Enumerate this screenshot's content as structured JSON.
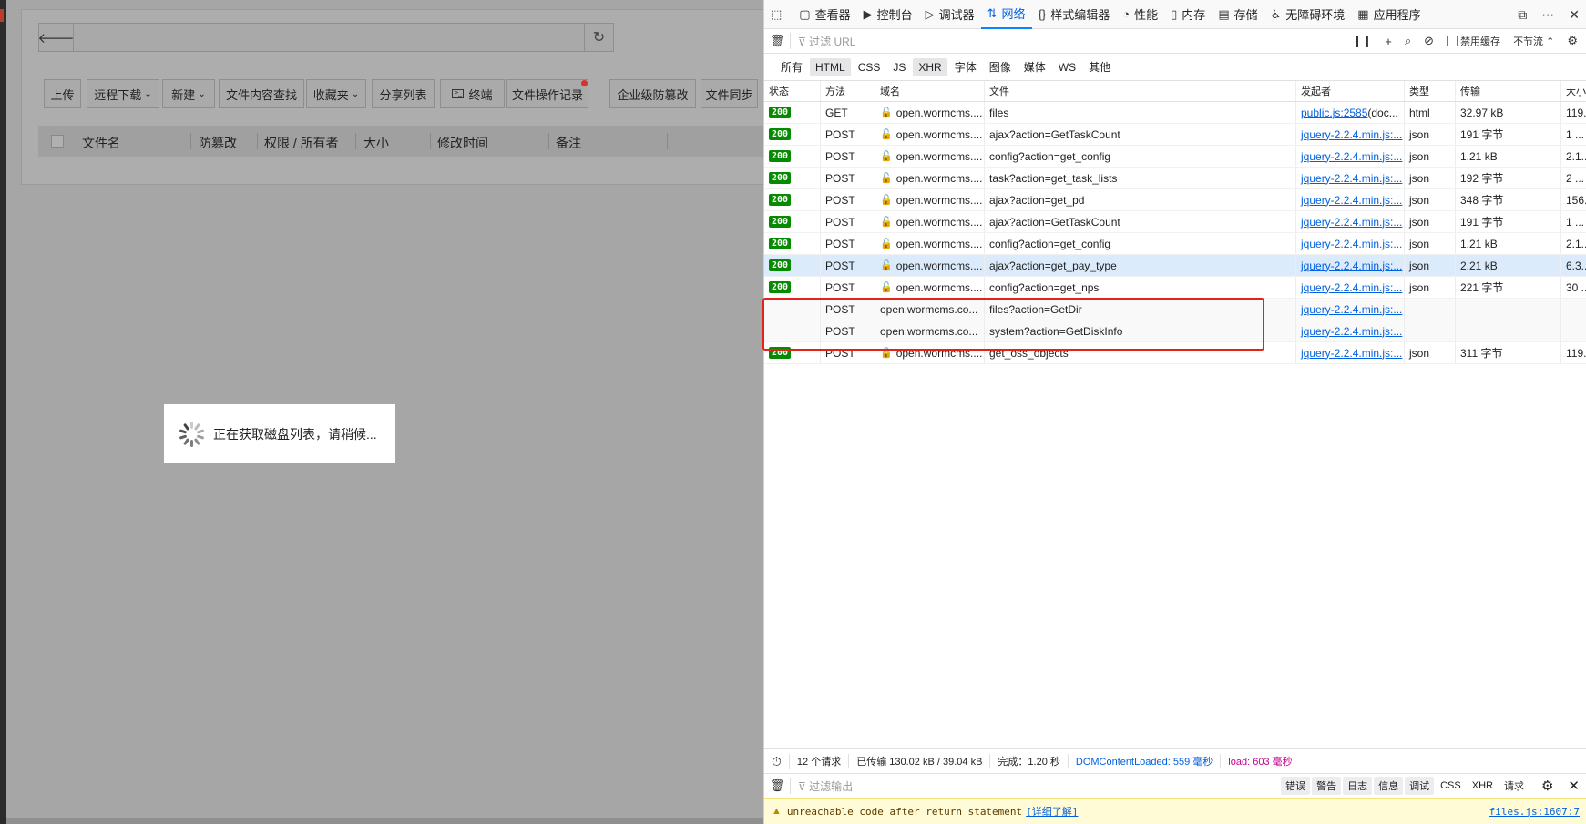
{
  "app": {
    "toolbar": [
      {
        "label": "上传"
      },
      {
        "label": "远程下载",
        "caret": true
      },
      {
        "label": "新建",
        "caret": true
      },
      {
        "label": "文件内容查找"
      },
      {
        "label": "收藏夹",
        "caret": true
      },
      {
        "label": "分享列表"
      },
      {
        "label": "终端",
        "icon": "terminal-icon"
      },
      {
        "label": "文件操作记录",
        "dot": true
      },
      {
        "label": "企业级防篡改"
      },
      {
        "label": "文件同步"
      }
    ],
    "columns": {
      "name": "文件名",
      "tamper": "防篡改",
      "perm": "权限 / 所有者",
      "size": "大小",
      "mtime": "修改时间",
      "note": "备注"
    },
    "loading_text": "正在获取磁盘列表，请稍候..."
  },
  "devtools": {
    "tabs": [
      {
        "icon": "▢",
        "label": "查看器"
      },
      {
        "icon": "▶",
        "label": "控制台"
      },
      {
        "icon": "▷",
        "label": "调试器"
      },
      {
        "icon": "⇅",
        "label": "网络",
        "active": true
      },
      {
        "icon": "{}",
        "label": "样式编辑器"
      },
      {
        "icon": "◔",
        "label": "性能"
      },
      {
        "icon": "▯",
        "label": "内存"
      },
      {
        "icon": "▤",
        "label": "存储"
      },
      {
        "icon": "♿",
        "label": "无障碍环境"
      },
      {
        "icon": "▦",
        "label": "应用程序"
      }
    ],
    "filter_placeholder": "过滤 URL",
    "disable_cache": "禁用缓存",
    "throttle": "不节流 ⌃",
    "types": [
      {
        "label": "所有"
      },
      {
        "label": "HTML",
        "on": true
      },
      {
        "label": "CSS"
      },
      {
        "label": "JS"
      },
      {
        "label": "XHR",
        "on": true
      },
      {
        "label": "字体"
      },
      {
        "label": "图像"
      },
      {
        "label": "媒体"
      },
      {
        "label": "WS"
      },
      {
        "label": "其他"
      }
    ],
    "headers": {
      "status": "状态",
      "method": "方法",
      "domain": "域名",
      "file": "文件",
      "initiator": "发起者",
      "type": "类型",
      "transferred": "传输",
      "size": "大小"
    },
    "requests": [
      {
        "status": "200",
        "method": "GET",
        "domain": "open.wormcms....",
        "insecure": true,
        "file": "files",
        "initiator": "public.js:2585",
        "initiator_extra": " (doc...",
        "type": "html",
        "transferred": "32.97 kB",
        "size": "119..."
      },
      {
        "status": "200",
        "method": "POST",
        "domain": "open.wormcms....",
        "insecure": true,
        "file": "ajax?action=GetTaskCount",
        "initiator": "jquery-2.2.4.min.js:...",
        "type": "json",
        "transferred": "191 字节",
        "size": "1 ..."
      },
      {
        "status": "200",
        "method": "POST",
        "domain": "open.wormcms....",
        "insecure": true,
        "file": "config?action=get_config",
        "initiator": "jquery-2.2.4.min.js:...",
        "type": "json",
        "transferred": "1.21 kB",
        "size": "2.1..."
      },
      {
        "status": "200",
        "method": "POST",
        "domain": "open.wormcms....",
        "insecure": true,
        "file": "task?action=get_task_lists",
        "initiator": "jquery-2.2.4.min.js:...",
        "type": "json",
        "transferred": "192 字节",
        "size": "2 ..."
      },
      {
        "status": "200",
        "method": "POST",
        "domain": "open.wormcms....",
        "insecure": true,
        "file": "ajax?action=get_pd",
        "initiator": "jquery-2.2.4.min.js:...",
        "type": "json",
        "transferred": "348 字节",
        "size": "156..."
      },
      {
        "status": "200",
        "method": "POST",
        "domain": "open.wormcms....",
        "insecure": true,
        "file": "ajax?action=GetTaskCount",
        "initiator": "jquery-2.2.4.min.js:...",
        "type": "json",
        "transferred": "191 字节",
        "size": "1 ..."
      },
      {
        "status": "200",
        "method": "POST",
        "domain": "open.wormcms....",
        "insecure": true,
        "file": "config?action=get_config",
        "initiator": "jquery-2.2.4.min.js:...",
        "type": "json",
        "transferred": "1.21 kB",
        "size": "2.1..."
      },
      {
        "status": "200",
        "method": "POST",
        "domain": "open.wormcms....",
        "insecure": true,
        "file": "ajax?action=get_pay_type",
        "initiator": "jquery-2.2.4.min.js:...",
        "type": "json",
        "transferred": "2.21 kB",
        "size": "6.3...",
        "selected": true
      },
      {
        "status": "200",
        "method": "POST",
        "domain": "open.wormcms....",
        "insecure": true,
        "file": "config?action=get_nps",
        "initiator": "jquery-2.2.4.min.js:...",
        "type": "json",
        "transferred": "221 字节",
        "size": "30 ..."
      },
      {
        "status": "",
        "method": "POST",
        "domain": "open.wormcms.co...",
        "insecure": false,
        "file": "files?action=GetDir",
        "initiator": "jquery-2.2.4.min.js:...",
        "type": "",
        "transferred": "",
        "size": "",
        "pending": true
      },
      {
        "status": "",
        "method": "POST",
        "domain": "open.wormcms.co...",
        "insecure": false,
        "file": "system?action=GetDiskInfo",
        "initiator": "jquery-2.2.4.min.js:...",
        "type": "",
        "transferred": "",
        "size": "",
        "pending": true
      },
      {
        "status": "200",
        "method": "POST",
        "domain": "open.wormcms....",
        "insecure": true,
        "file": "get_oss_objects",
        "initiator": "jquery-2.2.4.min.js:...",
        "type": "json",
        "transferred": "311 字节",
        "size": "119..."
      }
    ],
    "summary": {
      "requests": "12 个请求",
      "transferred": "已传输 130.02 kB / 39.04 kB",
      "finish": "完成：1.20 秒",
      "dcl": "DOMContentLoaded: 559 毫秒",
      "load": "load: 603 毫秒"
    },
    "console": {
      "filter_placeholder": "过滤输出",
      "levels": [
        {
          "label": "错误",
          "on": true
        },
        {
          "label": "警告",
          "on": true
        },
        {
          "label": "日志",
          "on": true
        },
        {
          "label": "信息",
          "on": true
        },
        {
          "label": "调试",
          "on": true
        },
        {
          "label": "CSS"
        },
        {
          "label": "XHR"
        },
        {
          "label": "请求"
        }
      ],
      "warning": "unreachable code after return statement",
      "learn_more": "[详细了解]",
      "source": "files.js:1607:7"
    }
  }
}
